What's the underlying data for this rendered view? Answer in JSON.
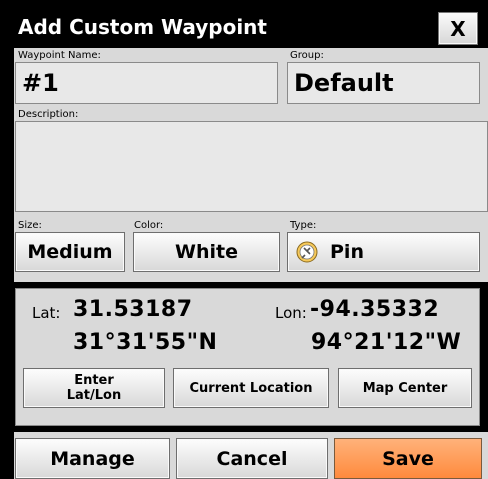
{
  "dialog": {
    "title": "Add Custom Waypoint",
    "close_label": "X"
  },
  "fields": {
    "name_label": "Waypoint Name:",
    "name_value": "#1",
    "group_label": "Group:",
    "group_value": "Default",
    "description_label": "Description:",
    "description_value": "",
    "size_label": "Size:",
    "size_value": "Medium",
    "color_label": "Color:",
    "color_value": "White",
    "type_label": "Type:",
    "type_value": "Pin",
    "type_icon": "pin-icon"
  },
  "coords": {
    "lat_label": "Lat:",
    "lat_decimal": "31.53187",
    "lat_dms": "31°31'55\"N",
    "lon_label": "Lon:",
    "lon_decimal": "-94.35332",
    "lon_dms": "94°21'12\"W"
  },
  "location_buttons": {
    "enter_latlon": "Enter\nLat/Lon",
    "current_location": "Current Location",
    "map_center": "Map Center"
  },
  "footer": {
    "manage": "Manage",
    "cancel": "Cancel",
    "save": "Save"
  },
  "colors": {
    "save_accent": "#ff9a50",
    "panel_bg": "#d9d9d9",
    "frame_bg": "#000000"
  }
}
